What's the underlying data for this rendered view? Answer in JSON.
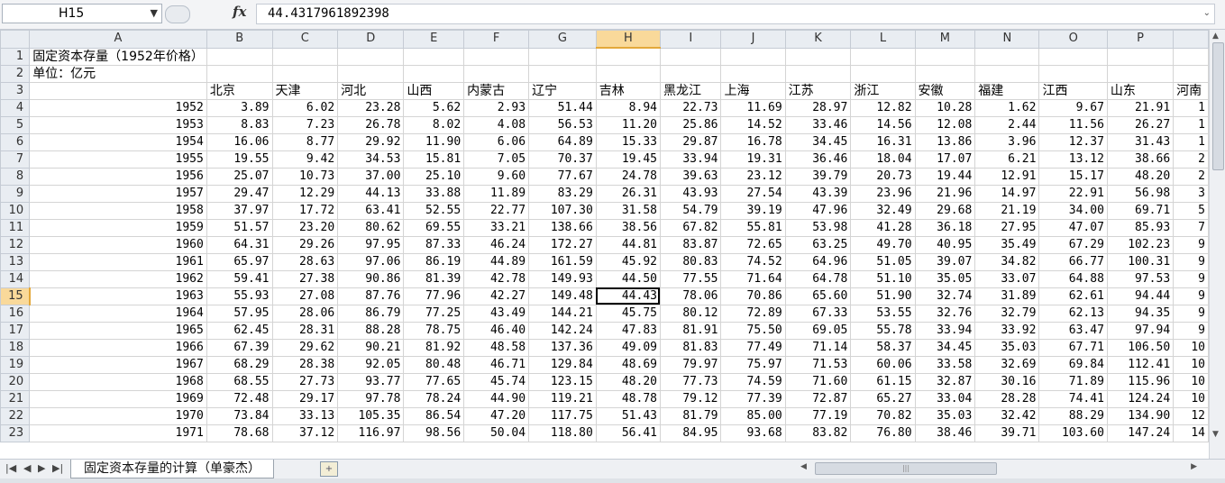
{
  "name_box": "H15",
  "formula_value": "44.4317961892398",
  "icons": {
    "fx": "fx-icon",
    "dropdown": "chevron-down-icon"
  },
  "columns": [
    "A",
    "B",
    "C",
    "D",
    "E",
    "F",
    "G",
    "H",
    "I",
    "J",
    "K",
    "L",
    "M",
    "N",
    "O",
    "P"
  ],
  "selected_column": "H",
  "selected_row": "15",
  "rows": [
    {
      "n": "1",
      "A": "固定资本存量（1952年价格）"
    },
    {
      "n": "2",
      "A": "单位：亿元"
    },
    {
      "n": "3",
      "headers": [
        "",
        "北京",
        "天津",
        "河北",
        "山西",
        "内蒙古",
        "辽宁",
        "吉林",
        "黑龙江",
        "上海",
        "江苏",
        "浙江",
        "安徽",
        "福建",
        "江西",
        "山东",
        "河南"
      ]
    },
    {
      "n": "4",
      "v": [
        "1952",
        "3.89",
        "6.02",
        "23.28",
        "5.62",
        "2.93",
        "51.44",
        "8.94",
        "22.73",
        "11.69",
        "28.97",
        "12.82",
        "10.28",
        "1.62",
        "9.67",
        "21.91",
        "1"
      ]
    },
    {
      "n": "5",
      "v": [
        "1953",
        "8.83",
        "7.23",
        "26.78",
        "8.02",
        "4.08",
        "56.53",
        "11.20",
        "25.86",
        "14.52",
        "33.46",
        "14.56",
        "12.08",
        "2.44",
        "11.56",
        "26.27",
        "1"
      ]
    },
    {
      "n": "6",
      "v": [
        "1954",
        "16.06",
        "8.77",
        "29.92",
        "11.90",
        "6.06",
        "64.89",
        "15.33",
        "29.87",
        "16.78",
        "34.45",
        "16.31",
        "13.86",
        "3.96",
        "12.37",
        "31.43",
        "1"
      ]
    },
    {
      "n": "7",
      "v": [
        "1955",
        "19.55",
        "9.42",
        "34.53",
        "15.81",
        "7.05",
        "70.37",
        "19.45",
        "33.94",
        "19.31",
        "36.46",
        "18.04",
        "17.07",
        "6.21",
        "13.12",
        "38.66",
        "2"
      ]
    },
    {
      "n": "8",
      "v": [
        "1956",
        "25.07",
        "10.73",
        "37.00",
        "25.10",
        "9.60",
        "77.67",
        "24.78",
        "39.63",
        "23.12",
        "39.79",
        "20.73",
        "19.44",
        "12.91",
        "15.17",
        "48.20",
        "2"
      ]
    },
    {
      "n": "9",
      "v": [
        "1957",
        "29.47",
        "12.29",
        "44.13",
        "33.88",
        "11.89",
        "83.29",
        "26.31",
        "43.93",
        "27.54",
        "43.39",
        "23.96",
        "21.96",
        "14.97",
        "22.91",
        "56.98",
        "3"
      ]
    },
    {
      "n": "10",
      "v": [
        "1958",
        "37.97",
        "17.72",
        "63.41",
        "52.55",
        "22.77",
        "107.30",
        "31.58",
        "54.79",
        "39.19",
        "47.96",
        "32.49",
        "29.68",
        "21.19",
        "34.00",
        "69.71",
        "5"
      ]
    },
    {
      "n": "11",
      "v": [
        "1959",
        "51.57",
        "23.20",
        "80.62",
        "69.55",
        "33.21",
        "138.66",
        "38.56",
        "67.82",
        "55.81",
        "53.98",
        "41.28",
        "36.18",
        "27.95",
        "47.07",
        "85.93",
        "7"
      ]
    },
    {
      "n": "12",
      "v": [
        "1960",
        "64.31",
        "29.26",
        "97.95",
        "87.33",
        "46.24",
        "172.27",
        "44.81",
        "83.87",
        "72.65",
        "63.25",
        "49.70",
        "40.95",
        "35.49",
        "67.29",
        "102.23",
        "9"
      ]
    },
    {
      "n": "13",
      "v": [
        "1961",
        "65.97",
        "28.63",
        "97.06",
        "86.19",
        "44.89",
        "161.59",
        "45.92",
        "80.83",
        "74.52",
        "64.96",
        "51.05",
        "39.07",
        "34.82",
        "66.77",
        "100.31",
        "9"
      ]
    },
    {
      "n": "14",
      "v": [
        "1962",
        "59.41",
        "27.38",
        "90.86",
        "81.39",
        "42.78",
        "149.93",
        "44.50",
        "77.55",
        "71.64",
        "64.78",
        "51.10",
        "35.05",
        "33.07",
        "64.88",
        "97.53",
        "9"
      ]
    },
    {
      "n": "15",
      "v": [
        "1963",
        "55.93",
        "27.08",
        "87.76",
        "77.96",
        "42.27",
        "149.48",
        "44.43",
        "78.06",
        "70.86",
        "65.60",
        "51.90",
        "32.74",
        "31.89",
        "62.61",
        "94.44",
        "9"
      ]
    },
    {
      "n": "16",
      "v": [
        "1964",
        "57.95",
        "28.06",
        "86.79",
        "77.25",
        "43.49",
        "144.21",
        "45.75",
        "80.12",
        "72.89",
        "67.33",
        "53.55",
        "32.76",
        "32.79",
        "62.13",
        "94.35",
        "9"
      ]
    },
    {
      "n": "17",
      "v": [
        "1965",
        "62.45",
        "28.31",
        "88.28",
        "78.75",
        "46.40",
        "142.24",
        "47.83",
        "81.91",
        "75.50",
        "69.05",
        "55.78",
        "33.94",
        "33.92",
        "63.47",
        "97.94",
        "9"
      ]
    },
    {
      "n": "18",
      "v": [
        "1966",
        "67.39",
        "29.62",
        "90.21",
        "81.92",
        "48.58",
        "137.36",
        "49.09",
        "81.83",
        "77.49",
        "71.14",
        "58.37",
        "34.45",
        "35.03",
        "67.71",
        "106.50",
        "10"
      ]
    },
    {
      "n": "19",
      "v": [
        "1967",
        "68.29",
        "28.38",
        "92.05",
        "80.48",
        "46.71",
        "129.84",
        "48.69",
        "79.97",
        "75.97",
        "71.53",
        "60.06",
        "33.58",
        "32.69",
        "69.84",
        "112.41",
        "10"
      ]
    },
    {
      "n": "20",
      "v": [
        "1968",
        "68.55",
        "27.73",
        "93.77",
        "77.65",
        "45.74",
        "123.15",
        "48.20",
        "77.73",
        "74.59",
        "71.60",
        "61.15",
        "32.87",
        "30.16",
        "71.89",
        "115.96",
        "10"
      ]
    },
    {
      "n": "21",
      "v": [
        "1969",
        "72.48",
        "29.17",
        "97.78",
        "78.24",
        "44.90",
        "119.21",
        "48.78",
        "79.12",
        "77.39",
        "72.87",
        "65.27",
        "33.04",
        "28.28",
        "74.41",
        "124.24",
        "10"
      ]
    },
    {
      "n": "22",
      "v": [
        "1970",
        "73.84",
        "33.13",
        "105.35",
        "86.54",
        "47.20",
        "117.75",
        "51.43",
        "81.79",
        "85.00",
        "77.19",
        "70.82",
        "35.03",
        "32.42",
        "88.29",
        "134.90",
        "12"
      ]
    },
    {
      "n": "23",
      "v": [
        "1971",
        "78.68",
        "37.12",
        "116.97",
        "98.56",
        "50.04",
        "118.80",
        "56.41",
        "84.95",
        "93.68",
        "83.82",
        "76.80",
        "38.46",
        "39.71",
        "103.60",
        "147.24",
        "14"
      ]
    }
  ],
  "sheet_tab": "固定资本存量的计算（单豪杰）"
}
